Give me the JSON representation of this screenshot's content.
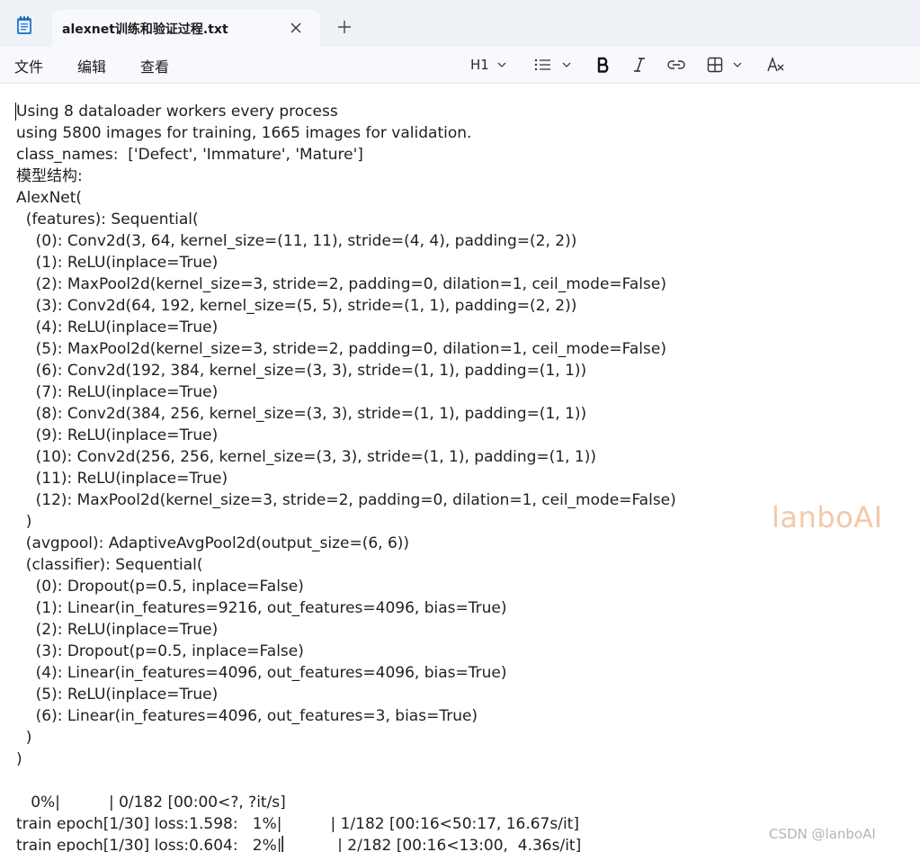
{
  "tab": {
    "title": "alexnet训练和验证过程.txt"
  },
  "menu": {
    "file": "文件",
    "edit": "编辑",
    "view": "查看"
  },
  "toolbar": {
    "heading": "H1"
  },
  "icons": {
    "app": "notepad-icon",
    "close": "close-icon",
    "new_tab": "plus-icon",
    "heading_dropdown": "chevron-down-icon",
    "list": "list-icon",
    "bold": "bold-icon",
    "italic": "italic-icon",
    "link": "link-icon",
    "table": "table-icon",
    "clear_format": "clear-format-icon"
  },
  "colors": {
    "titlebar": "#eef2f6",
    "menubar": "#f7f9fc",
    "watermark": "#f4c8a9"
  },
  "document": {
    "lines": [
      "Using 8 dataloader workers every process",
      "using 5800 images for training, 1665 images for validation.",
      "class_names:  ['Defect', 'Immature', 'Mature']",
      "模型结构:",
      "AlexNet(",
      "  (features): Sequential(",
      "    (0): Conv2d(3, 64, kernel_size=(11, 11), stride=(4, 4), padding=(2, 2))",
      "    (1): ReLU(inplace=True)",
      "    (2): MaxPool2d(kernel_size=3, stride=2, padding=0, dilation=1, ceil_mode=False)",
      "    (3): Conv2d(64, 192, kernel_size=(5, 5), stride=(1, 1), padding=(2, 2))",
      "    (4): ReLU(inplace=True)",
      "    (5): MaxPool2d(kernel_size=3, stride=2, padding=0, dilation=1, ceil_mode=False)",
      "    (6): Conv2d(192, 384, kernel_size=(3, 3), stride=(1, 1), padding=(1, 1))",
      "    (7): ReLU(inplace=True)",
      "    (8): Conv2d(384, 256, kernel_size=(3, 3), stride=(1, 1), padding=(1, 1))",
      "    (9): ReLU(inplace=True)",
      "    (10): Conv2d(256, 256, kernel_size=(3, 3), stride=(1, 1), padding=(1, 1))",
      "    (11): ReLU(inplace=True)",
      "    (12): MaxPool2d(kernel_size=3, stride=2, padding=0, dilation=1, ceil_mode=False)",
      "  )",
      "  (avgpool): AdaptiveAvgPool2d(output_size=(6, 6))",
      "  (classifier): Sequential(",
      "    (0): Dropout(p=0.5, inplace=False)",
      "    (1): Linear(in_features=9216, out_features=4096, bias=True)",
      "    (2): ReLU(inplace=True)",
      "    (3): Dropout(p=0.5, inplace=False)",
      "    (4): Linear(in_features=4096, out_features=4096, bias=True)",
      "    (5): ReLU(inplace=True)",
      "    (6): Linear(in_features=4096, out_features=3, bias=True)",
      "  )",
      ")",
      "",
      "   0%|          | 0/182 [00:00<?, ?it/s]",
      "train epoch[1/30] loss:1.598:   1%|          | 1/182 [00:16<50:17, 16.67s/it]",
      "train epoch[1/30] loss:0.604:   2%|▏         | 2/182 [00:16<13:00,  4.36s/it]"
    ]
  },
  "watermark": "lanboAI",
  "credit": "CSDN @lanboAI"
}
